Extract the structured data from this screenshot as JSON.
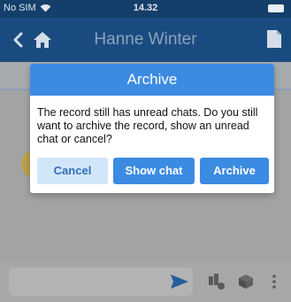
{
  "status_bar": {
    "carrier": "No SIM",
    "time": "14.32"
  },
  "header": {
    "title": "Hanne Winter"
  },
  "dialog": {
    "title": "Archive",
    "message": "The record still has unread chats. Do you still want to archive the record, show an unread chat or cancel?",
    "buttons": {
      "cancel": "Cancel",
      "show_chat": "Show chat",
      "archive": "Archive"
    }
  },
  "colors": {
    "accent": "#3c8be2",
    "header": "#1a4b80",
    "status_bar": "#143f6a",
    "overlay": "#a3a3a3"
  },
  "icons": {
    "back": "chevron-left-icon",
    "home": "home-icon",
    "document": "document-icon",
    "wifi": "wifi-icon",
    "battery": "battery-icon",
    "send": "send-icon",
    "tool_a": "puzzle-tool-icon",
    "tool_b": "cube-icon",
    "more": "more-vertical-icon"
  }
}
